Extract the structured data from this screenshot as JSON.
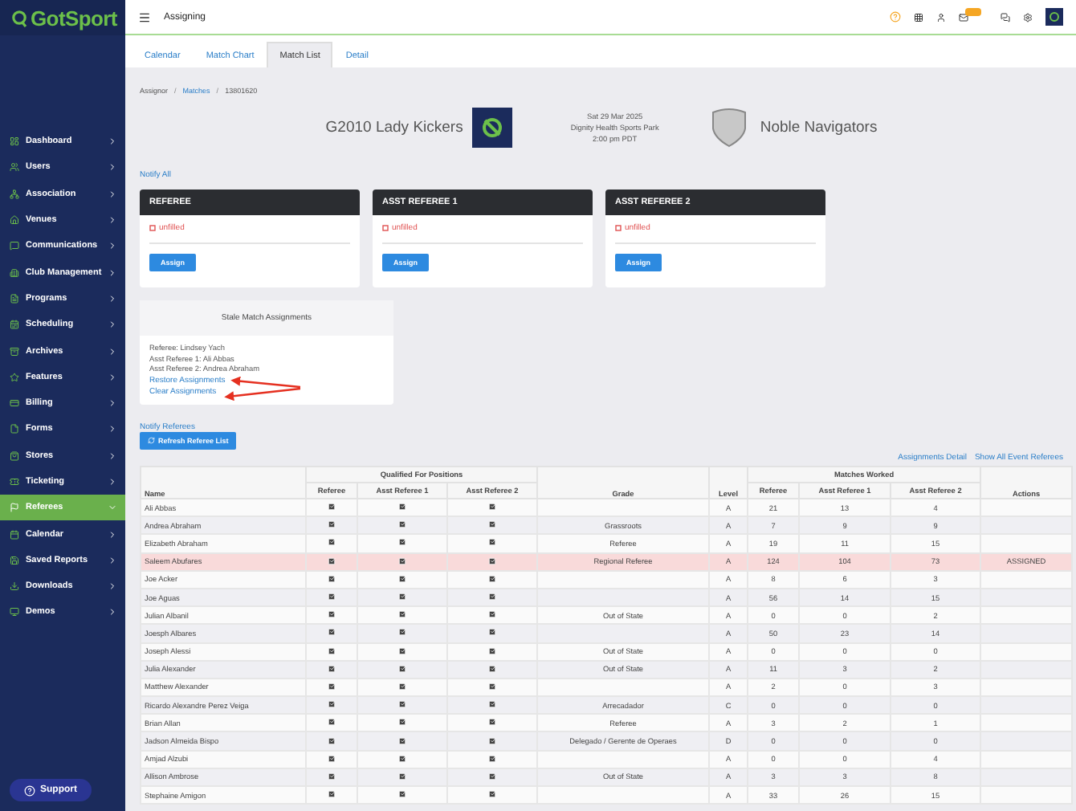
{
  "sidebar": {
    "logo": "GotSport",
    "items": [
      {
        "label": "Dashboard",
        "selected": false
      },
      {
        "label": "Users",
        "selected": false
      },
      {
        "label": "Association",
        "selected": false
      },
      {
        "label": "Venues",
        "selected": false
      },
      {
        "label": "Communications",
        "selected": false
      },
      {
        "label": "Club Management",
        "selected": false
      },
      {
        "label": "Programs",
        "selected": false
      },
      {
        "label": "Scheduling",
        "selected": false
      },
      {
        "label": "Archives",
        "selected": false
      },
      {
        "label": "Features",
        "selected": false
      },
      {
        "label": "Billing",
        "selected": false
      },
      {
        "label": "Forms",
        "selected": false
      },
      {
        "label": "Stores",
        "selected": false
      },
      {
        "label": "Ticketing",
        "selected": false
      },
      {
        "label": "Referees",
        "selected": true
      },
      {
        "label": "Calendar",
        "selected": false
      },
      {
        "label": "Saved Reports",
        "selected": false
      },
      {
        "label": "Downloads",
        "selected": false
      },
      {
        "label": "Demos",
        "selected": false
      }
    ],
    "support": "Support"
  },
  "header": {
    "title": "Assigning"
  },
  "tabs": [
    {
      "label": "Calendar",
      "selected": false
    },
    {
      "label": "Match Chart",
      "selected": false
    },
    {
      "label": "Match List",
      "selected": true
    },
    {
      "label": "Detail",
      "selected": false
    }
  ],
  "breadcrumb": [
    {
      "label": "Assignor",
      "link": false
    },
    {
      "separator": "/",
      "label": "Matches",
      "link": true
    },
    {
      "separator": "/",
      "label": "13801620",
      "link": false
    }
  ],
  "match": {
    "home": "G2010 Lady Kickers",
    "date": "Sat 29 Mar 2025",
    "venue": "Dignity Health Sports Park",
    "time": "2:00 pm PDT",
    "away": "Noble Navigators"
  },
  "notify_all": "Notify All",
  "positions": [
    {
      "title": "REFEREE",
      "status": "unfilled",
      "button": "Assign"
    },
    {
      "title": "ASST REFEREE 1",
      "status": "unfilled",
      "button": "Assign"
    },
    {
      "title": "ASST REFEREE 2",
      "status": "unfilled",
      "button": "Assign"
    }
  ],
  "stale": {
    "title": "Stale Match Assignments",
    "lines": [
      "Referee: Lindsey Yach",
      "Asst Referee 1: Ali Abbas",
      "Asst Referee 2: Andrea Abraham"
    ],
    "links": [
      "Restore Assignments",
      "Clear Assignments"
    ]
  },
  "notify_referees": "Notify Referees",
  "refresh_button": "Refresh Referee List",
  "table_links": [
    "Assignments Detail",
    "Show All Event Referees"
  ],
  "table": {
    "group_headers": [
      "Qualified For Positions",
      "Matches Worked"
    ],
    "columns": [
      "Name",
      "Referee",
      "Asst Referee 1",
      "Asst Referee 2",
      "Grade",
      "Level",
      "Referee",
      "Asst Referee 1",
      "Asst Referee 2",
      "Actions"
    ],
    "rows": [
      {
        "name": "Ali Abbas",
        "qualified": [
          true,
          true,
          true
        ],
        "grade": "",
        "level": "A",
        "worked": [
          "21",
          "13",
          "4"
        ],
        "action": "",
        "highlighted": false
      },
      {
        "name": "Andrea Abraham",
        "qualified": [
          true,
          true,
          true
        ],
        "grade": "Grassroots",
        "level": "A",
        "worked": [
          "7",
          "9",
          "9"
        ],
        "action": "",
        "highlighted": false
      },
      {
        "name": "Elizabeth Abraham",
        "qualified": [
          true,
          true,
          true
        ],
        "grade": "Referee",
        "level": "A",
        "worked": [
          "19",
          "11",
          "15"
        ],
        "action": "",
        "highlighted": false
      },
      {
        "name": "Saleem Abufares",
        "qualified": [
          true,
          true,
          true
        ],
        "grade": "Regional Referee",
        "level": "A",
        "worked": [
          "124",
          "104",
          "73"
        ],
        "action": "ASSIGNED",
        "highlighted": true
      },
      {
        "name": "Joe Acker",
        "qualified": [
          true,
          true,
          true
        ],
        "grade": "",
        "level": "A",
        "worked": [
          "8",
          "6",
          "3"
        ],
        "action": "",
        "highlighted": false
      },
      {
        "name": "Joe Aguas",
        "qualified": [
          true,
          true,
          true
        ],
        "grade": "",
        "level": "A",
        "worked": [
          "56",
          "14",
          "15"
        ],
        "action": "",
        "highlighted": false
      },
      {
        "name": "Julian Albanil",
        "qualified": [
          true,
          true,
          true
        ],
        "grade": "Out of State",
        "level": "A",
        "worked": [
          "0",
          "0",
          "2"
        ],
        "action": "",
        "highlighted": false
      },
      {
        "name": "Joesph Albares",
        "qualified": [
          true,
          true,
          true
        ],
        "grade": "",
        "level": "A",
        "worked": [
          "50",
          "23",
          "14"
        ],
        "action": "",
        "highlighted": false
      },
      {
        "name": "Joseph Alessi",
        "qualified": [
          true,
          true,
          true
        ],
        "grade": "Out of State",
        "level": "A",
        "worked": [
          "0",
          "0",
          "0"
        ],
        "action": "",
        "highlighted": false
      },
      {
        "name": "Julia Alexander",
        "qualified": [
          true,
          true,
          true
        ],
        "grade": "Out of State",
        "level": "A",
        "worked": [
          "11",
          "3",
          "2"
        ],
        "action": "",
        "highlighted": false
      },
      {
        "name": "Matthew Alexander",
        "qualified": [
          true,
          true,
          true
        ],
        "grade": "",
        "level": "A",
        "worked": [
          "2",
          "0",
          "3"
        ],
        "action": "",
        "highlighted": false
      },
      {
        "name": "Ricardo Alexandre Perez Veiga",
        "qualified": [
          true,
          true,
          true
        ],
        "grade": "Arrecadador",
        "level": "C",
        "worked": [
          "0",
          "0",
          "0"
        ],
        "action": "",
        "highlighted": false
      },
      {
        "name": "Brian Allan",
        "qualified": [
          true,
          true,
          true
        ],
        "grade": "Referee",
        "level": "A",
        "worked": [
          "3",
          "2",
          "1"
        ],
        "action": "",
        "highlighted": false
      },
      {
        "name": "Jadson Almeida Bispo",
        "qualified": [
          true,
          true,
          true
        ],
        "grade": "Delegado / Gerente de Operaes",
        "level": "D",
        "worked": [
          "0",
          "0",
          "0"
        ],
        "action": "",
        "highlighted": false
      },
      {
        "name": "Amjad Alzubi",
        "qualified": [
          true,
          true,
          true
        ],
        "grade": "",
        "level": "A",
        "worked": [
          "0",
          "0",
          "4"
        ],
        "action": "",
        "highlighted": false
      },
      {
        "name": "Allison Ambrose",
        "qualified": [
          true,
          true,
          true
        ],
        "grade": "Out of State",
        "level": "A",
        "worked": [
          "3",
          "3",
          "8"
        ],
        "action": "",
        "highlighted": false
      },
      {
        "name": "Stephaine Amigon",
        "qualified": [
          true,
          true,
          true
        ],
        "grade": "",
        "level": "A",
        "worked": [
          "33",
          "26",
          "15"
        ],
        "action": "",
        "highlighted": false
      }
    ]
  }
}
